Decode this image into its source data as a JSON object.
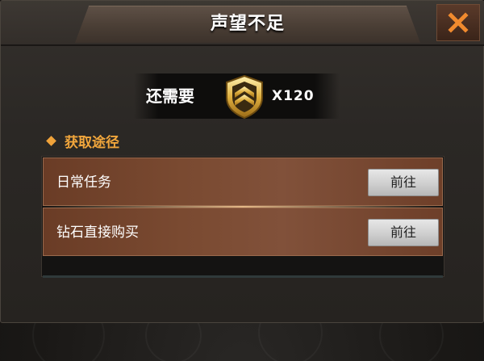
{
  "dialog": {
    "title": "声望不足",
    "close_label": "X"
  },
  "requirement": {
    "label": "还需要",
    "icon": "reputation-badge-icon",
    "count": "X120"
  },
  "section": {
    "title": "获取途径"
  },
  "methods": [
    {
      "label": "日常任务",
      "button": "前往"
    },
    {
      "label": "钻石直接购买",
      "button": "前往"
    }
  ],
  "colors": {
    "accent": "#f1a63c",
    "close_x": "#f08a2e",
    "row_fill": "#7a4a31"
  }
}
